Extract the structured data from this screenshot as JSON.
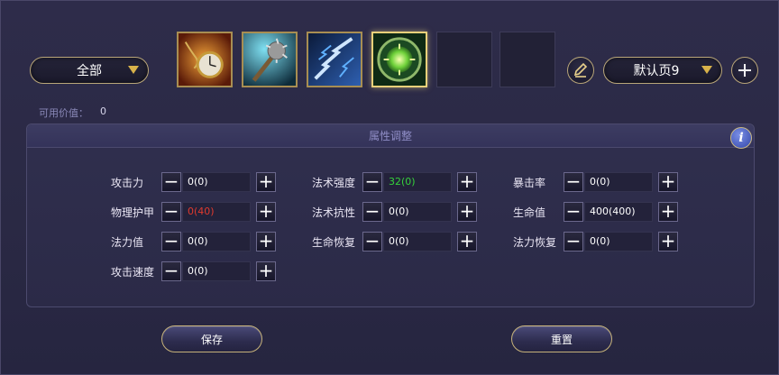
{
  "category_dropdown": {
    "selected": "全部"
  },
  "page_dropdown": {
    "selected": "默认页9"
  },
  "item_slots": [
    {
      "icon": "pocket-watch-icon",
      "state": "filled"
    },
    {
      "icon": "spiked-mace-icon",
      "state": "filled"
    },
    {
      "icon": "lightning-chain-icon",
      "state": "filled"
    },
    {
      "icon": "green-orb-amulet-icon",
      "state": "selected"
    },
    {
      "icon": "empty-slot",
      "state": "empty"
    },
    {
      "icon": "empty-slot",
      "state": "empty"
    }
  ],
  "available_value": {
    "label": "可用价值：",
    "value": "0"
  },
  "panel": {
    "title": "属性调整",
    "info_icon": "i"
  },
  "stats": [
    {
      "label": "攻击力",
      "value": "0(0)",
      "color": "white"
    },
    {
      "label": "法术强度",
      "value": "32(0)",
      "color": "green"
    },
    {
      "label": "暴击率",
      "value": "0(0)",
      "color": "white"
    },
    {
      "label": "物理护甲",
      "value": "0(40)",
      "color": "red"
    },
    {
      "label": "法术抗性",
      "value": "0(0)",
      "color": "white"
    },
    {
      "label": "生命值",
      "value": "400(400)",
      "color": "white"
    },
    {
      "label": "法力值",
      "value": "0(0)",
      "color": "white"
    },
    {
      "label": "生命恢复",
      "value": "0(0)",
      "color": "white"
    },
    {
      "label": "法力恢复",
      "value": "0(0)",
      "color": "white"
    },
    {
      "label": "攻击速度",
      "value": "0(0)",
      "color": "white"
    }
  ],
  "minus_symbol": "−",
  "plus_symbol": "+",
  "buttons": {
    "save": "保存",
    "reset": "重置"
  },
  "colors": {
    "gold_border": "#b9a679",
    "green_value": "#35d23a",
    "red_value": "#e03a2e"
  }
}
